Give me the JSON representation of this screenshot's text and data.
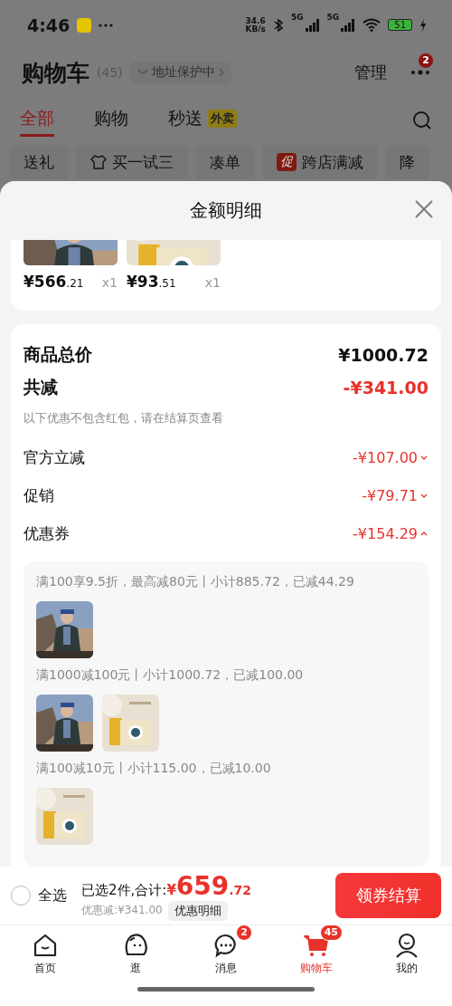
{
  "status_bar": {
    "time": "4:46",
    "speed": "34.6",
    "speed_unit": "KB/s",
    "networks": [
      "5G",
      "5G"
    ],
    "battery": "51"
  },
  "header": {
    "title": "购物车",
    "count": "(45)",
    "address": "地址保护中",
    "manage": "管理",
    "badge": "2"
  },
  "tabs": [
    {
      "label": "全部",
      "selected": true
    },
    {
      "label": "购物",
      "selected": false
    },
    {
      "label": "秒送",
      "tag": "外卖",
      "selected": false
    }
  ],
  "chips": [
    {
      "label": "送礼",
      "kind": "plain"
    },
    {
      "label": "买一试三",
      "kind": "icon"
    },
    {
      "label": "凑单",
      "kind": "plain"
    },
    {
      "label": "跨店满减",
      "kind": "promo",
      "badge": "促"
    },
    {
      "label": "降",
      "kind": "plain"
    }
  ],
  "sheet": {
    "title": "金额明细",
    "products": [
      {
        "kind": "picture",
        "price": "¥566",
        "decimals": ".21",
        "qty": "x1"
      },
      {
        "kind": "picture",
        "price": "¥93",
        "decimals": ".51",
        "qty": "x1"
      }
    ],
    "total": {
      "label": "商品总价",
      "value": "¥1000.72"
    },
    "reduction": {
      "label": "共减",
      "value": "-¥341.00",
      "note": "以下优惠不包含红包，请在结算页查看"
    },
    "discounts": [
      {
        "label": "官方立减",
        "value": "-¥107.00",
        "expanded": false
      },
      {
        "label": "促销",
        "value": "-¥79.71",
        "expanded": false
      },
      {
        "label": "优惠券",
        "value": "-¥154.29",
        "expanded": true
      }
    ],
    "coupon_groups": [
      {
        "text": "满100享9.5折，最高减80元丨小计885.72，已减44.29"
      },
      {
        "text": "满1000减100元丨小计1000.72，已减100.00"
      },
      {
        "text": "满100减10元丨小计115.00，已减10.00"
      }
    ]
  },
  "footer": {
    "select_all": {
      "label": "全选",
      "checked": false
    },
    "summary": "已选2件,合计:",
    "currency": "¥",
    "amount": "659",
    "decimals": ".72",
    "discount": "优惠减:¥341.00",
    "detail_button": "优惠明细",
    "checkout": "领券结算"
  },
  "nav": [
    {
      "label": "首页",
      "selected": false
    },
    {
      "label": "逛",
      "selected": false
    },
    {
      "label": "消息",
      "badge": "2",
      "selected": false
    },
    {
      "label": "购物车",
      "badge": "45",
      "selected": true
    },
    {
      "label": "我的",
      "selected": false
    }
  ]
}
